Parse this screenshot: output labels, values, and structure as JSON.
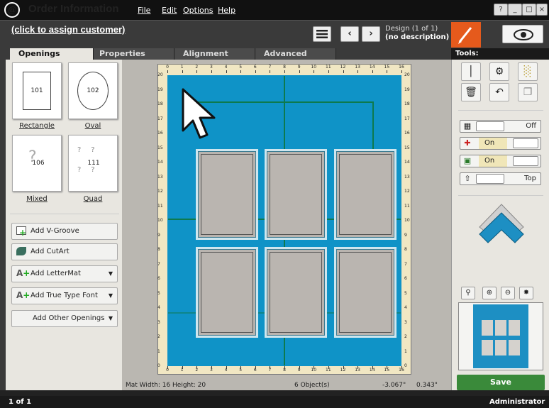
{
  "titlebar": {
    "logo": "@",
    "title": "Order Information",
    "menus": [
      "File",
      "Edit",
      "Options",
      "Help"
    ],
    "win_buttons": [
      "?",
      "_",
      "□",
      "×"
    ]
  },
  "header": {
    "customer_link": "(click to assign customer)",
    "design_line1": "Design  (1 of 1)",
    "design_line2": "(no description)"
  },
  "tabs": [
    {
      "label": "Openings",
      "active": true
    },
    {
      "label": "Properties",
      "active": false
    },
    {
      "label": "Alignment",
      "active": false
    },
    {
      "label": "Advanced",
      "active": false
    }
  ],
  "tools_header": "Tools:",
  "openings": [
    {
      "label": "Rectangle",
      "code": "101"
    },
    {
      "label": "Oval",
      "code": "102"
    },
    {
      "label": "Mixed",
      "code": "106"
    },
    {
      "label": "Quad",
      "code": "111"
    }
  ],
  "add_buttons": [
    {
      "label": "Add V-Groove",
      "icon": "v-groove-icon",
      "dropdown": false
    },
    {
      "label": "Add CutArt",
      "icon": "cutart-icon",
      "dropdown": false
    },
    {
      "label": "Add LetterMat",
      "icon": "lettermat-icon",
      "dropdown": true
    },
    {
      "label": "Add True Type Font",
      "icon": "font-icon",
      "dropdown": true
    },
    {
      "label": "Add Other Openings",
      "icon": "",
      "dropdown": true
    }
  ],
  "toggles": [
    {
      "name": "bevel-toggle",
      "value": "Off"
    },
    {
      "name": "crosshair-toggle",
      "value": "On"
    },
    {
      "name": "snap-toggle",
      "value": "On"
    },
    {
      "name": "layer-toggle",
      "value": "Top"
    }
  ],
  "ruler": {
    "top_ticks": [
      "0",
      "1",
      "2",
      "3",
      "4",
      "5",
      "6",
      "7",
      "8",
      "9",
      "10",
      "11",
      "12",
      "13",
      "14",
      "15",
      "16"
    ],
    "side_ticks": [
      "20",
      "19",
      "18",
      "17",
      "16",
      "15",
      "14",
      "13",
      "12",
      "11",
      "10",
      "9",
      "8",
      "7",
      "6",
      "5",
      "4",
      "3",
      "2",
      "1",
      "0"
    ]
  },
  "info": {
    "mat_size": "Mat  Width: 16  Height: 20",
    "objects": "6 Object(s)",
    "x": "-3.067\"",
    "y": "0.343\""
  },
  "save_label": "Save",
  "status": {
    "page": "1 of 1",
    "user": "Administrator"
  },
  "colors": {
    "mat": "#0f93c7",
    "accent": "#e55a1c",
    "save": "#3a8a3a"
  }
}
